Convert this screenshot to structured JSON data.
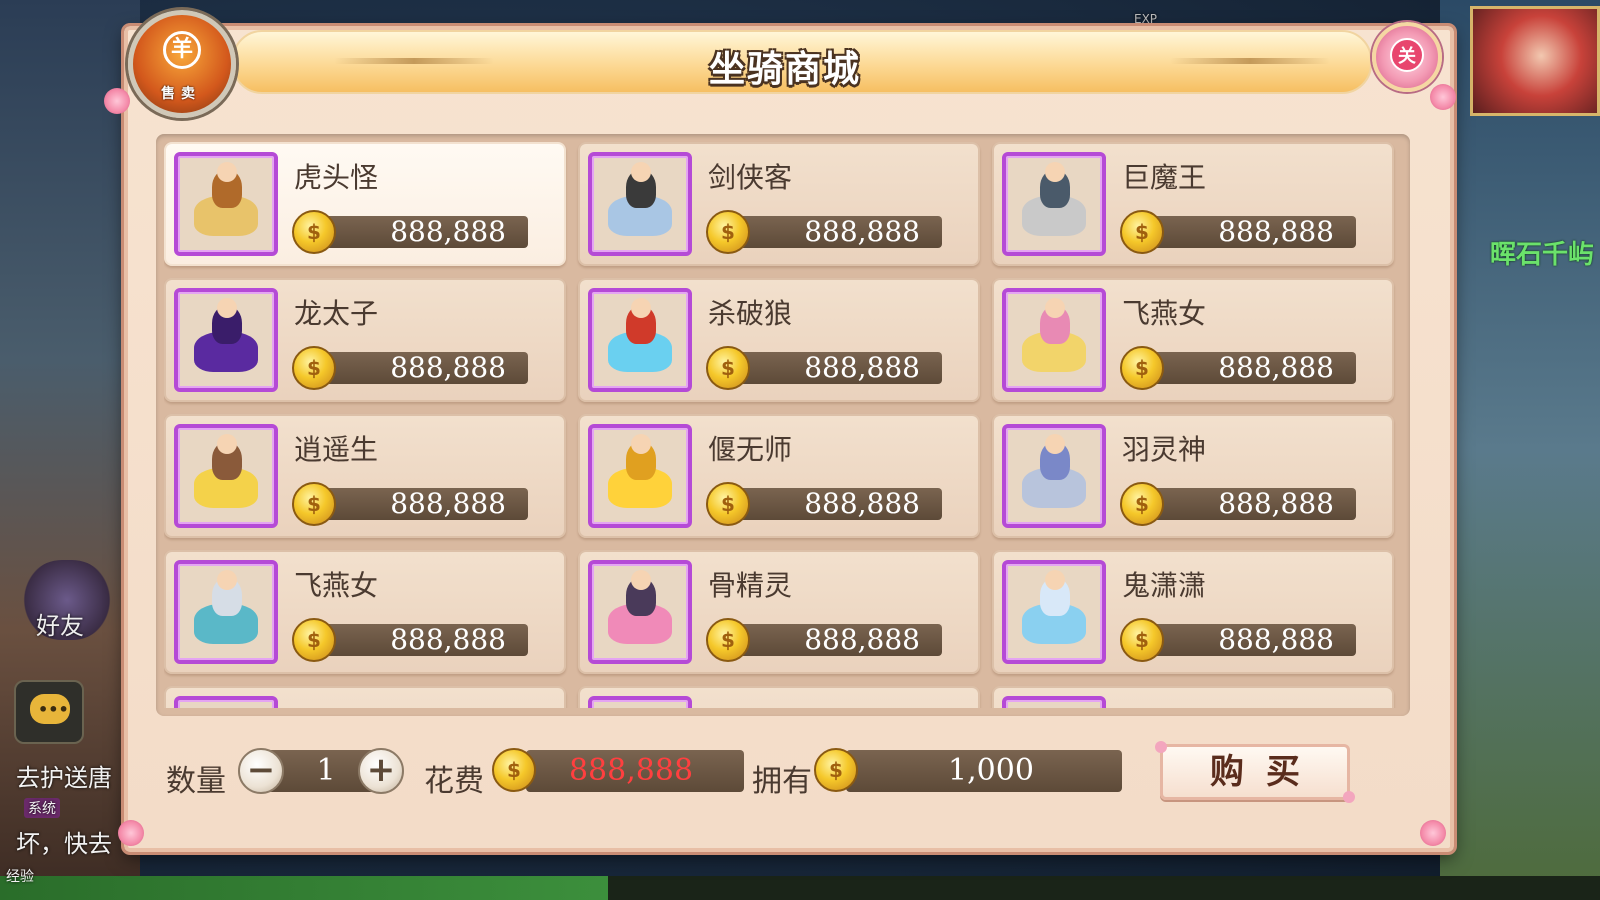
{
  "background": {
    "quest_text_1": "去护送唐",
    "quest_text_2": "坏，快去",
    "system_tag": "系统",
    "friend_label": "好友",
    "right_text": "晖石千屿",
    "exp_label": "EXP",
    "bottom_label": "经验"
  },
  "shop": {
    "title": "坐骑商城",
    "sell_button_symbol": "羊",
    "sell_button_label": "售卖",
    "close_symbol": "关",
    "items": [
      {
        "name": "虎头怪",
        "price": "888,888",
        "selected": true,
        "mount_color": "#e8c36a",
        "rider_color": "#b06a2a"
      },
      {
        "name": "剑侠客",
        "price": "888,888",
        "selected": false,
        "mount_color": "#a9c6e4",
        "rider_color": "#3a3a3a"
      },
      {
        "name": "巨魔王",
        "price": "888,888",
        "selected": false,
        "mount_color": "#c9c9c9",
        "rider_color": "#4a5a6a"
      },
      {
        "name": "龙太子",
        "price": "888,888",
        "selected": false,
        "mount_color": "#5a2aa0",
        "rider_color": "#3a1d6a"
      },
      {
        "name": "杀破狼",
        "price": "888,888",
        "selected": false,
        "mount_color": "#6ad0f0",
        "rider_color": "#d03a2a"
      },
      {
        "name": "飞燕女",
        "price": "888,888",
        "selected": false,
        "mount_color": "#f2d46a",
        "rider_color": "#e88ab4"
      },
      {
        "name": "逍遥生",
        "price": "888,888",
        "selected": false,
        "mount_color": "#f4d24a",
        "rider_color": "#8a5a3a"
      },
      {
        "name": "偃无师",
        "price": "888,888",
        "selected": false,
        "mount_color": "#ffd23a",
        "rider_color": "#e0a020"
      },
      {
        "name": "羽灵神",
        "price": "888,888",
        "selected": false,
        "mount_color": "#b8c4dc",
        "rider_color": "#7a88c8"
      },
      {
        "name": "飞燕女",
        "price": "888,888",
        "selected": false,
        "mount_color": "#5ab8c8",
        "rider_color": "#d6dde6"
      },
      {
        "name": "骨精灵",
        "price": "888,888",
        "selected": false,
        "mount_color": "#f08ab8",
        "rider_color": "#4a3a5a"
      },
      {
        "name": "鬼潇潇",
        "price": "888,888",
        "selected": false,
        "mount_color": "#8ad0f0",
        "rider_color": "#d8e8f8"
      }
    ]
  },
  "footer": {
    "quantity_label": "数量",
    "quantity_value": "1",
    "minus_symbol": "−",
    "plus_symbol": "+",
    "cost_label": "花费",
    "cost_value": "888,888",
    "own_label": "拥有",
    "own_value": "1,000",
    "buy_label": "购买"
  },
  "colors": {
    "accent_purple": "#b54ad6",
    "cost_red": "#ff3f3f",
    "coin_gold": "#f5c82a"
  }
}
